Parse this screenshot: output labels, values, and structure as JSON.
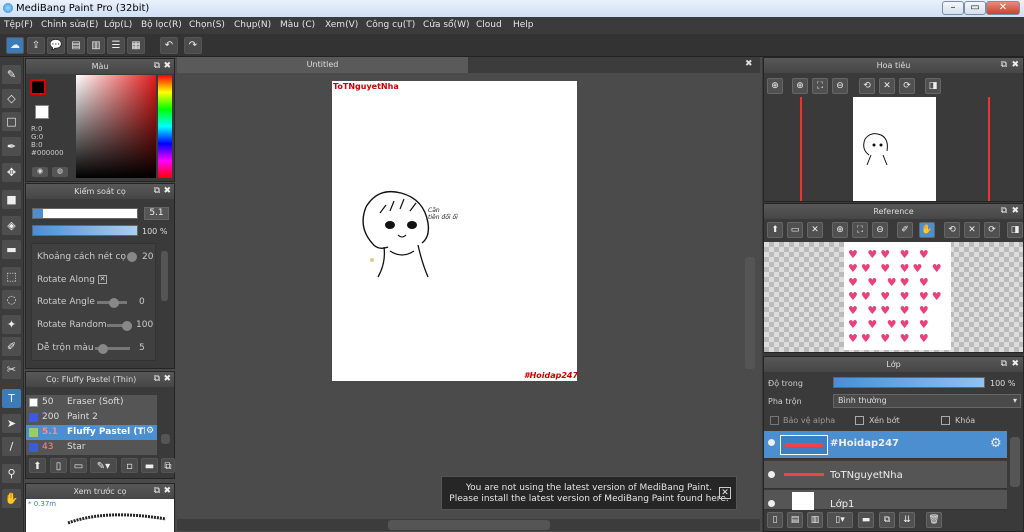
{
  "window": {
    "title": "MediBang Paint Pro (32bit)"
  },
  "menu": [
    "Tệp(F)",
    "Chỉnh sửa(E)",
    "Lớp(L)",
    "Bộ lọc(R)",
    "Chọn(S)",
    "Chụp(N)",
    "Màu (C)",
    "Xem(V)",
    "Công cụ(T)",
    "Cửa sổ(W)",
    "Cloud",
    "Help"
  ],
  "panels": {
    "color": {
      "title": "Màu",
      "rgb": [
        "R:0",
        "G:0",
        "B:0"
      ],
      "hex": "#000000",
      "primary": "#000000"
    },
    "brush_control": {
      "title": "Kiểm soát cọ",
      "size": "5.1",
      "opacity": "100 %",
      "rows": [
        {
          "label": "Khoảng cách nét cọ",
          "value": "20"
        },
        {
          "label": "Rotate Along",
          "value": ""
        },
        {
          "label": "Rotate Angle",
          "value": "0"
        },
        {
          "label": "Rotate Random",
          "value": "100"
        },
        {
          "label": "Dễ trộn màu",
          "value": "5"
        }
      ]
    },
    "brush": {
      "title": "Cọ: Fluffy Pastel (Thin)",
      "items": [
        {
          "size": "50",
          "name": "Eraser (Soft)",
          "color": "#ffffff"
        },
        {
          "size": "200",
          "name": "Paint 2",
          "color": "#3b5bdb"
        },
        {
          "size": "5.1",
          "name": "Fluffy Pastel (Thin)",
          "color": "#9ccc65"
        },
        {
          "size": "43",
          "name": "Star",
          "color": "#3b5bdb"
        }
      ]
    },
    "preview": {
      "title": "Xem trước cọ",
      "zoom": "* 0.37m"
    },
    "canvas": {
      "tab": "Untitled",
      "watermark_top": "ToTNguyetNha",
      "watermark_bottom": "#Hoidap247",
      "scribble_text": "Cần\ntiền đổi ổi"
    },
    "navigator": {
      "title": "Hoa tiêu"
    },
    "reference": {
      "title": "Reference"
    },
    "layers": {
      "title": "Lớp",
      "opacity_label": "Độ trong",
      "opacity": "100 %",
      "blend_label": "Pha trộn",
      "blend": "Bình thường",
      "check_protect": "Bảo vệ alpha",
      "check_clip": "Xén bớt",
      "check_lock": "Khóa",
      "items": [
        {
          "name": "#Hoidap247"
        },
        {
          "name": "ToTNguyetNha"
        },
        {
          "name": "Lớp1"
        }
      ]
    }
  },
  "notice": {
    "line1": "You are not using the latest version of MediBang Paint.",
    "line2": "Please install the latest version of MediBang Paint found here."
  },
  "colors": {
    "accent": "#4b8fd0",
    "watermark": "#cc0000"
  }
}
